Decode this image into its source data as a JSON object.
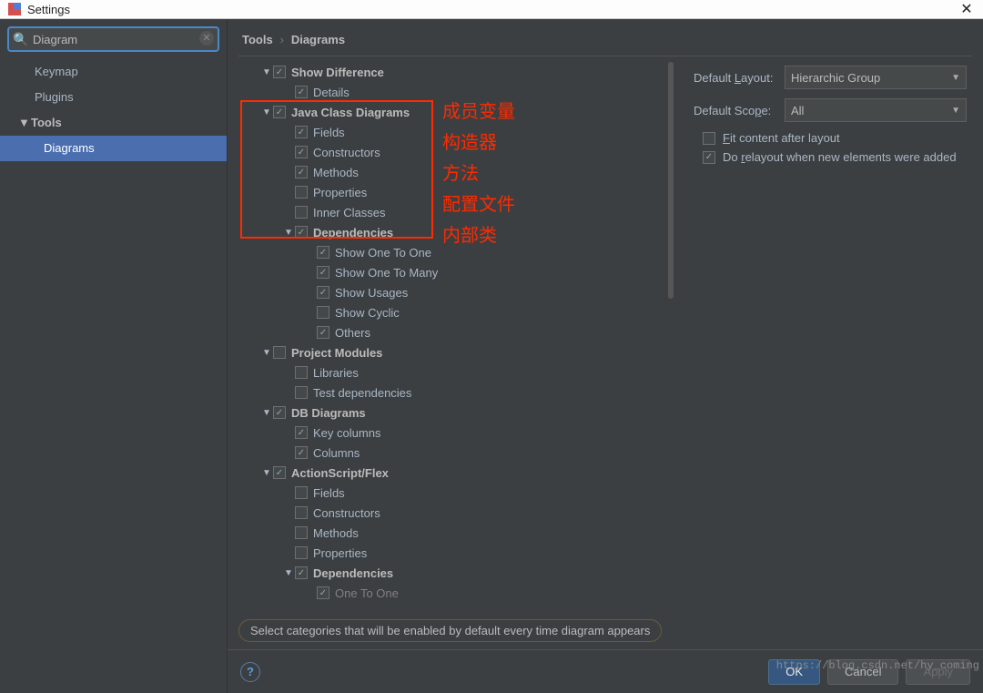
{
  "titlebar": {
    "title": "Settings"
  },
  "search": {
    "value": "Diagram"
  },
  "sidebar": {
    "keymap": "Keymap",
    "plugins": "Plugins",
    "tools": "Tools",
    "diagrams": "Diagrams"
  },
  "breadcrumb": {
    "root": "Tools",
    "leaf": "Diagrams"
  },
  "tree": {
    "show_difference": "Show Difference",
    "details": "Details",
    "java_class_diagrams": "Java Class Diagrams",
    "fields": "Fields",
    "constructors": "Constructors",
    "methods": "Methods",
    "properties": "Properties",
    "inner_classes": "Inner Classes",
    "dependencies": "Dependencies",
    "show_one_to_one": "Show One To One",
    "show_one_to_many": "Show One To Many",
    "show_usages": "Show Usages",
    "show_cyclic": "Show Cyclic",
    "others": "Others",
    "project_modules": "Project Modules",
    "libraries": "Libraries",
    "test_dependencies": "Test dependencies",
    "db_diagrams": "DB Diagrams",
    "key_columns": "Key columns",
    "columns": "Columns",
    "actionscript_flex": "ActionScript/Flex",
    "as_fields": "Fields",
    "as_constructors": "Constructors",
    "as_methods": "Methods",
    "as_properties": "Properties",
    "as_dependencies": "Dependencies",
    "as_one_to_one": "One To One"
  },
  "rightpane": {
    "default_layout_label": "Default Layout:",
    "default_layout_value": "Hierarchic Group",
    "default_scope_label": "Default Scope:",
    "default_scope_value": "All",
    "fit_content": "Fit content after layout",
    "do_relayout": "Do relayout when new elements were added"
  },
  "hint": "Select categories that will be enabled by default every time diagram appears",
  "footer": {
    "ok": "OK",
    "cancel": "Cancel",
    "apply": "Apply"
  },
  "annotations": {
    "a1": "成员变量",
    "a2": "构造器",
    "a3": "方法",
    "a4": "配置文件",
    "a5": "内部类"
  },
  "watermark": "https://blog.csdn.net/hy_coming"
}
